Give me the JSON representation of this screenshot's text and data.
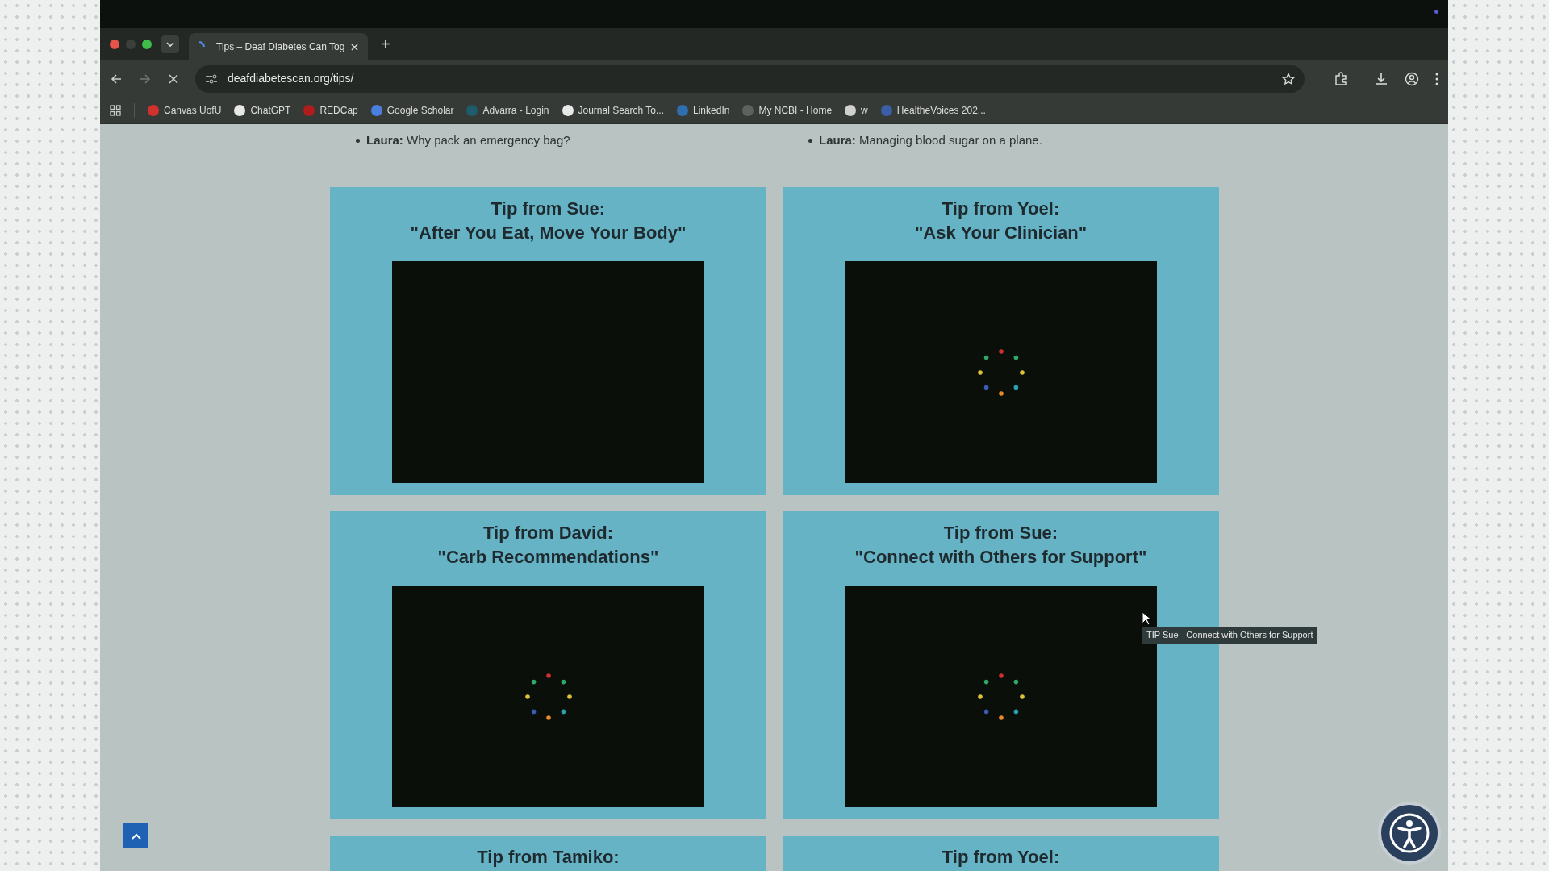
{
  "browser": {
    "tab": {
      "title": "Tips – Deaf Diabetes Can Tog",
      "loading": true
    },
    "new_tab": "+",
    "url": "deafdiabetescan.org/tips/",
    "bookmarks": [
      {
        "label": "Canvas UofU",
        "color": "#d0312d"
      },
      {
        "label": "ChatGPT",
        "color": "#e8e8e8"
      },
      {
        "label": "REDCap",
        "color": "#b01c1c"
      },
      {
        "label": "Google Scholar",
        "color": "#4a7fe0"
      },
      {
        "label": "Advarra - Login",
        "color": "#1e5b6b"
      },
      {
        "label": "Journal Search To...",
        "color": "#e8e8e8"
      },
      {
        "label": "LinkedIn",
        "color": "#2f6fb0"
      },
      {
        "label": "My NCBI - Home",
        "color": "#5c625e"
      },
      {
        "label": "w",
        "color": "#d0d0d0"
      },
      {
        "label": "HealtheVoices 202...",
        "color": "#3a5fa8"
      }
    ]
  },
  "list": [
    {
      "speaker": "Laura:",
      "text": "Why pack an emergency bag?"
    },
    {
      "speaker": "Laura:",
      "text": "Managing blood sugar on a plane."
    }
  ],
  "cards": [
    {
      "title": "Tip from Sue:",
      "subtitle": "\"After You Eat, Move Your Body\"",
      "video": {
        "loading": false
      }
    },
    {
      "title": "Tip from Yoel:",
      "subtitle": "\"Ask Your Clinician\"",
      "video": {
        "loading": true
      }
    },
    {
      "title": "Tip from David:",
      "subtitle": "\"Carb Recommendations\"",
      "video": {
        "loading": true
      }
    },
    {
      "title": "Tip from Sue:",
      "subtitle": "\"Connect with Others for Support\"",
      "video": {
        "loading": true
      }
    },
    {
      "title": "Tip from Tamiko:"
    },
    {
      "title": "Tip from Yoel:"
    }
  ],
  "tooltip": "TIP Sue - Connect with Others for Support"
}
